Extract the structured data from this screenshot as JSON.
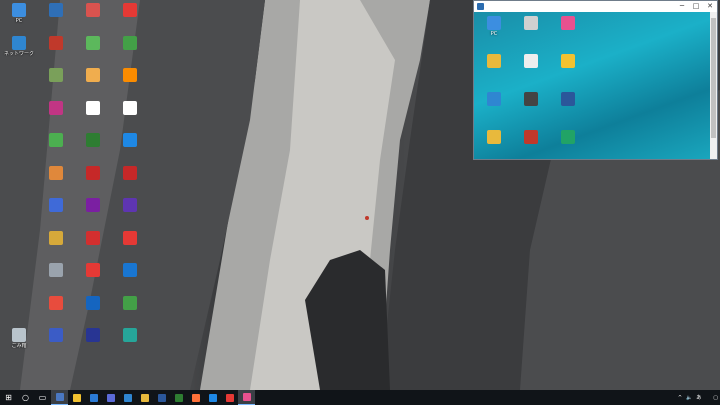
{
  "desktop": {
    "icons": [
      {
        "id": "pc",
        "label": "PC",
        "col": 0,
        "row": 0,
        "color": "#3c8ee0"
      },
      {
        "id": "network",
        "label": "ネットワーク",
        "col": 0,
        "row": 1,
        "color": "#2f86d1"
      },
      {
        "id": "recycle",
        "label": "ごみ箱",
        "col": 0,
        "row": 10,
        "color": "#b9c4cc"
      },
      {
        "id": "c1",
        "label": "",
        "col": 1,
        "row": 0,
        "color": "#2f6fb7"
      },
      {
        "id": "c2",
        "label": "",
        "col": 1,
        "row": 1,
        "color": "#c0392b"
      },
      {
        "id": "c3",
        "label": "",
        "col": 1,
        "row": 2,
        "color": "#7aa05a"
      },
      {
        "id": "c4",
        "label": "",
        "col": 1,
        "row": 3,
        "color": "#c13584"
      },
      {
        "id": "c5",
        "label": "",
        "col": 1,
        "row": 4,
        "color": "#4caf50"
      },
      {
        "id": "c6",
        "label": "",
        "col": 1,
        "row": 5,
        "color": "#e0883b"
      },
      {
        "id": "c7",
        "label": "",
        "col": 1,
        "row": 6,
        "color": "#3f6ad8"
      },
      {
        "id": "c8",
        "label": "",
        "col": 1,
        "row": 7,
        "color": "#d6a93a"
      },
      {
        "id": "c9",
        "label": "",
        "col": 1,
        "row": 8,
        "color": "#9aa3ad"
      },
      {
        "id": "c10",
        "label": "",
        "col": 1,
        "row": 9,
        "color": "#e84c3d"
      },
      {
        "id": "c11",
        "label": "",
        "col": 1,
        "row": 10,
        "color": "#3b5cc6"
      },
      {
        "id": "d1",
        "label": "",
        "col": 2,
        "row": 0,
        "color": "#d9534f"
      },
      {
        "id": "d2",
        "label": "",
        "col": 2,
        "row": 1,
        "color": "#5cb85c"
      },
      {
        "id": "d3",
        "label": "",
        "col": 2,
        "row": 2,
        "color": "#f0ad4e"
      },
      {
        "id": "d4",
        "label": "",
        "col": 2,
        "row": 3,
        "color": "#ffffff"
      },
      {
        "id": "d5",
        "label": "",
        "col": 2,
        "row": 4,
        "color": "#2e7d32"
      },
      {
        "id": "d6",
        "label": "",
        "col": 2,
        "row": 5,
        "color": "#c62828"
      },
      {
        "id": "d7",
        "label": "",
        "col": 2,
        "row": 6,
        "color": "#7b1fa2"
      },
      {
        "id": "d8",
        "label": "",
        "col": 2,
        "row": 7,
        "color": "#d32f2f"
      },
      {
        "id": "d9",
        "label": "",
        "col": 2,
        "row": 8,
        "color": "#e53935"
      },
      {
        "id": "d10",
        "label": "",
        "col": 2,
        "row": 9,
        "color": "#1565c0"
      },
      {
        "id": "d11",
        "label": "",
        "col": 2,
        "row": 10,
        "color": "#283593"
      },
      {
        "id": "e1",
        "label": "",
        "col": 3,
        "row": 0,
        "color": "#e53935"
      },
      {
        "id": "e2",
        "label": "",
        "col": 3,
        "row": 1,
        "color": "#43a047"
      },
      {
        "id": "e3",
        "label": "",
        "col": 3,
        "row": 2,
        "color": "#fb8c00"
      },
      {
        "id": "e4",
        "label": "",
        "col": 3,
        "row": 3,
        "color": "#ffffff"
      },
      {
        "id": "e5",
        "label": "",
        "col": 3,
        "row": 4,
        "color": "#1e88e5"
      },
      {
        "id": "e6",
        "label": "",
        "col": 3,
        "row": 5,
        "color": "#c62828"
      },
      {
        "id": "e7",
        "label": "",
        "col": 3,
        "row": 6,
        "color": "#5e35b1"
      },
      {
        "id": "e8",
        "label": "",
        "col": 3,
        "row": 7,
        "color": "#e53935"
      },
      {
        "id": "e9",
        "label": "",
        "col": 3,
        "row": 8,
        "color": "#1976d2"
      },
      {
        "id": "e10",
        "label": "",
        "col": 3,
        "row": 9,
        "color": "#43a047"
      },
      {
        "id": "e11",
        "label": "",
        "col": 3,
        "row": 10,
        "color": "#26a69a"
      }
    ]
  },
  "remote_window": {
    "title": "",
    "minimize_glyph": "─",
    "maximize_glyph": "□",
    "close_glyph": "✕",
    "icons": [
      {
        "id": "r-pc",
        "label": "PC",
        "col": 0,
        "row": 0,
        "color": "#3c8ee0"
      },
      {
        "id": "r-2",
        "label": "",
        "col": 1,
        "row": 0,
        "color": "#d0d0d0"
      },
      {
        "id": "r-3",
        "label": "",
        "col": 2,
        "row": 0,
        "color": "#e8518f"
      },
      {
        "id": "r-4",
        "label": "",
        "col": 0,
        "row": 1,
        "color": "#e8b93c"
      },
      {
        "id": "r-5",
        "label": "",
        "col": 1,
        "row": 1,
        "color": "#eeeeee"
      },
      {
        "id": "r-6",
        "label": "",
        "col": 2,
        "row": 1,
        "color": "#f2c230"
      },
      {
        "id": "r-7",
        "label": "",
        "col": 0,
        "row": 2,
        "color": "#2f86d1"
      },
      {
        "id": "r-8",
        "label": "",
        "col": 1,
        "row": 2,
        "color": "#444444"
      },
      {
        "id": "r-9",
        "label": "",
        "col": 2,
        "row": 2,
        "color": "#2b579a"
      },
      {
        "id": "r-10",
        "label": "",
        "col": 0,
        "row": 3,
        "color": "#e8b93c"
      },
      {
        "id": "r-11",
        "label": "",
        "col": 1,
        "row": 3,
        "color": "#c0392b"
      },
      {
        "id": "r-12",
        "label": "",
        "col": 2,
        "row": 3,
        "color": "#21a366"
      }
    ]
  },
  "taskbar": {
    "start_glyph": "⊞",
    "search_glyph": "○",
    "taskview_glyph": "▭",
    "apps": [
      {
        "id": "task-remote",
        "color": "#4a78c2",
        "active": true
      },
      {
        "id": "task-explorer",
        "color": "#f2c230",
        "active": false
      },
      {
        "id": "task-store",
        "color": "#2b7bd6",
        "active": false
      },
      {
        "id": "task-app4",
        "color": "#5b6bd8",
        "active": false
      },
      {
        "id": "task-app5",
        "color": "#2f86d1",
        "active": false
      },
      {
        "id": "task-chrome",
        "color": "#e8b93c",
        "active": false
      },
      {
        "id": "task-app7",
        "color": "#2b579a",
        "active": false
      },
      {
        "id": "task-app8",
        "color": "#2e7d32",
        "active": false
      },
      {
        "id": "task-firefox",
        "color": "#ff7139",
        "active": false
      },
      {
        "id": "task-edge",
        "color": "#1e88e5",
        "active": false
      },
      {
        "id": "task-app11",
        "color": "#e53935",
        "active": false
      },
      {
        "id": "task-app12",
        "color": "#e8518f",
        "active": true
      }
    ],
    "tray": {
      "caret": "^",
      "ime": "あ",
      "time": "",
      "date": ""
    }
  }
}
